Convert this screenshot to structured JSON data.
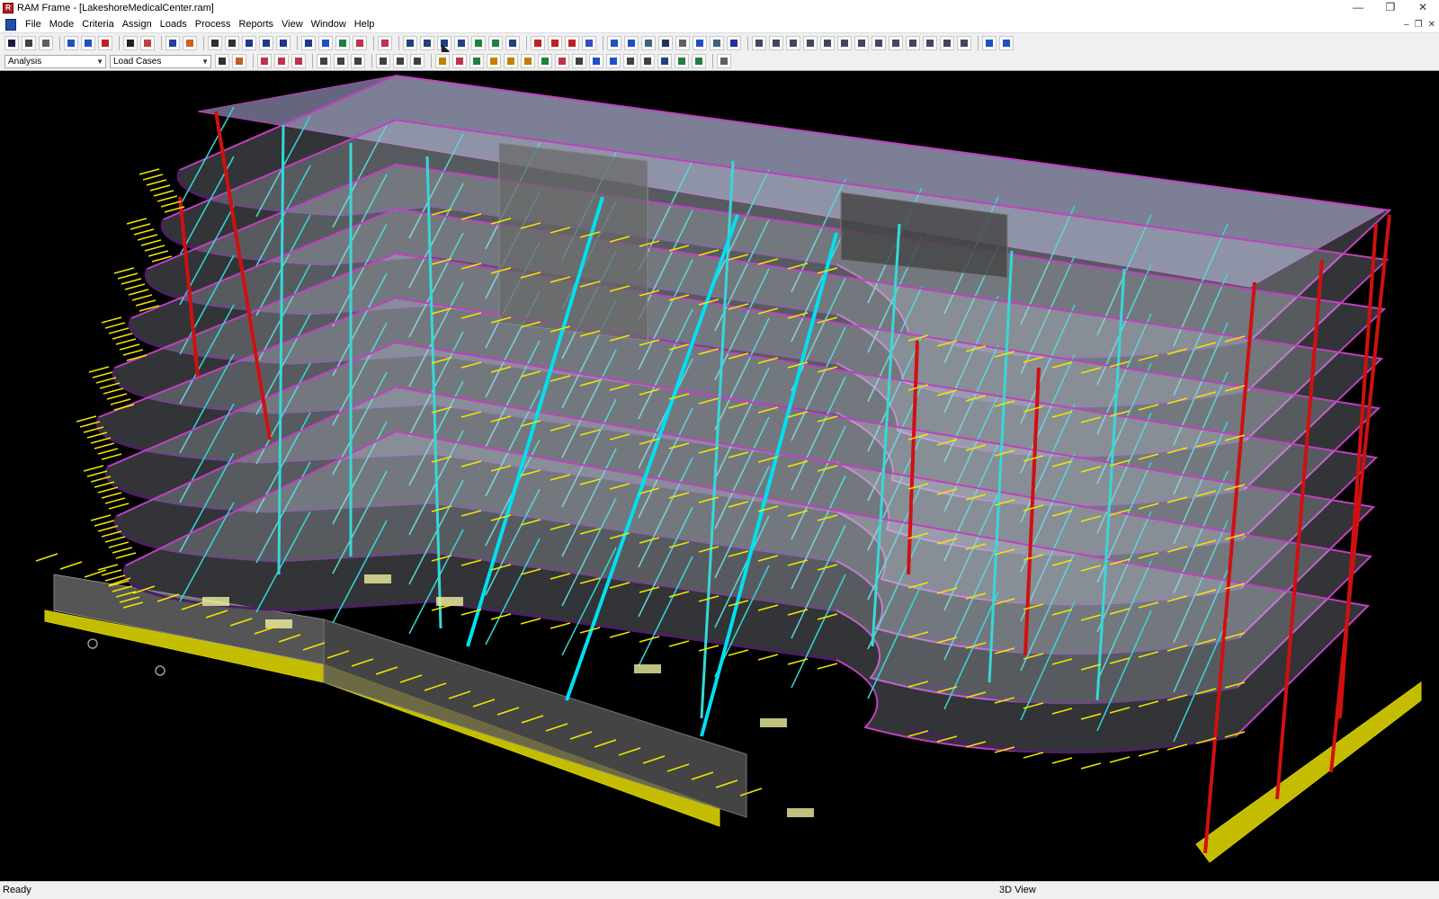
{
  "app": {
    "title": "RAM Frame - [LakeshoreMedicalCenter.ram]",
    "window_controls": [
      "minimize-icon",
      "restore-icon",
      "close-icon"
    ],
    "mdi_controls": [
      "minimize-icon",
      "restore-icon",
      "close-icon"
    ]
  },
  "menu": {
    "items": [
      "File",
      "Mode",
      "Criteria",
      "Assign",
      "Loads",
      "Process",
      "Reports",
      "View",
      "Window",
      "Help"
    ]
  },
  "toolbar2": {
    "mode_select": "Analysis",
    "case_select": "Load Cases"
  },
  "viewport": {
    "label": "3D View",
    "colors": {
      "background": "#000000",
      "beam": "#37d8d8",
      "column_red": "#d01010",
      "load_arrow": "#f2e600",
      "edge": "#c040c0",
      "slab": "#c8d0dc",
      "foundation": "#d8d000",
      "brace": "#00e0f0"
    }
  },
  "status": {
    "left": "Ready",
    "right": "3D View"
  }
}
